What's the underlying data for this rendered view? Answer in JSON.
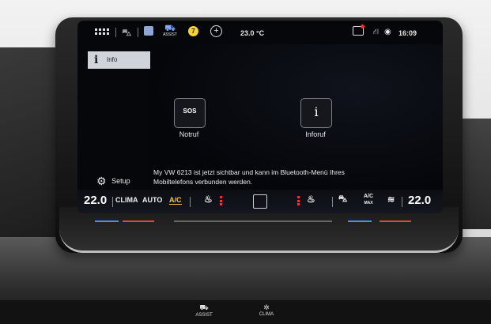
{
  "status_bar": {
    "temperature": "23.0 °C",
    "time": "16:09",
    "assist_label": "ASSIST",
    "badge_count": "7",
    "icons": [
      "apps-grid-icon",
      "car-icon",
      "media-icon",
      "assist-icon",
      "notification-badge",
      "add-icon",
      "message-icon",
      "network-icon",
      "globe-icon"
    ]
  },
  "sidebar": {
    "tab_label": "Info",
    "setup_label": "Setup"
  },
  "tiles": [
    {
      "icon_text": "SOS",
      "label": "Notruf"
    },
    {
      "icon_text": "i",
      "label": "Inforuf"
    }
  ],
  "toast": {
    "message": "My VW 6213 ist jetzt sichtbar und kann im Bluetooth-Menü Ihres Mobiltelefons verbunden werden."
  },
  "climate_bar": {
    "left_temp": "22.0",
    "climate_label": "CLIMA",
    "auto_label": "AUTO",
    "ac_label": "A/C",
    "ac_max_top": "A/C",
    "ac_max_bottom": "MAX",
    "right_temp": "22.0",
    "accent_color": "#f3c94a",
    "heat_color": "#e33333"
  },
  "physical_buttons": [
    {
      "label": "ASSIST"
    },
    {
      "label": "CLIMA"
    }
  ]
}
